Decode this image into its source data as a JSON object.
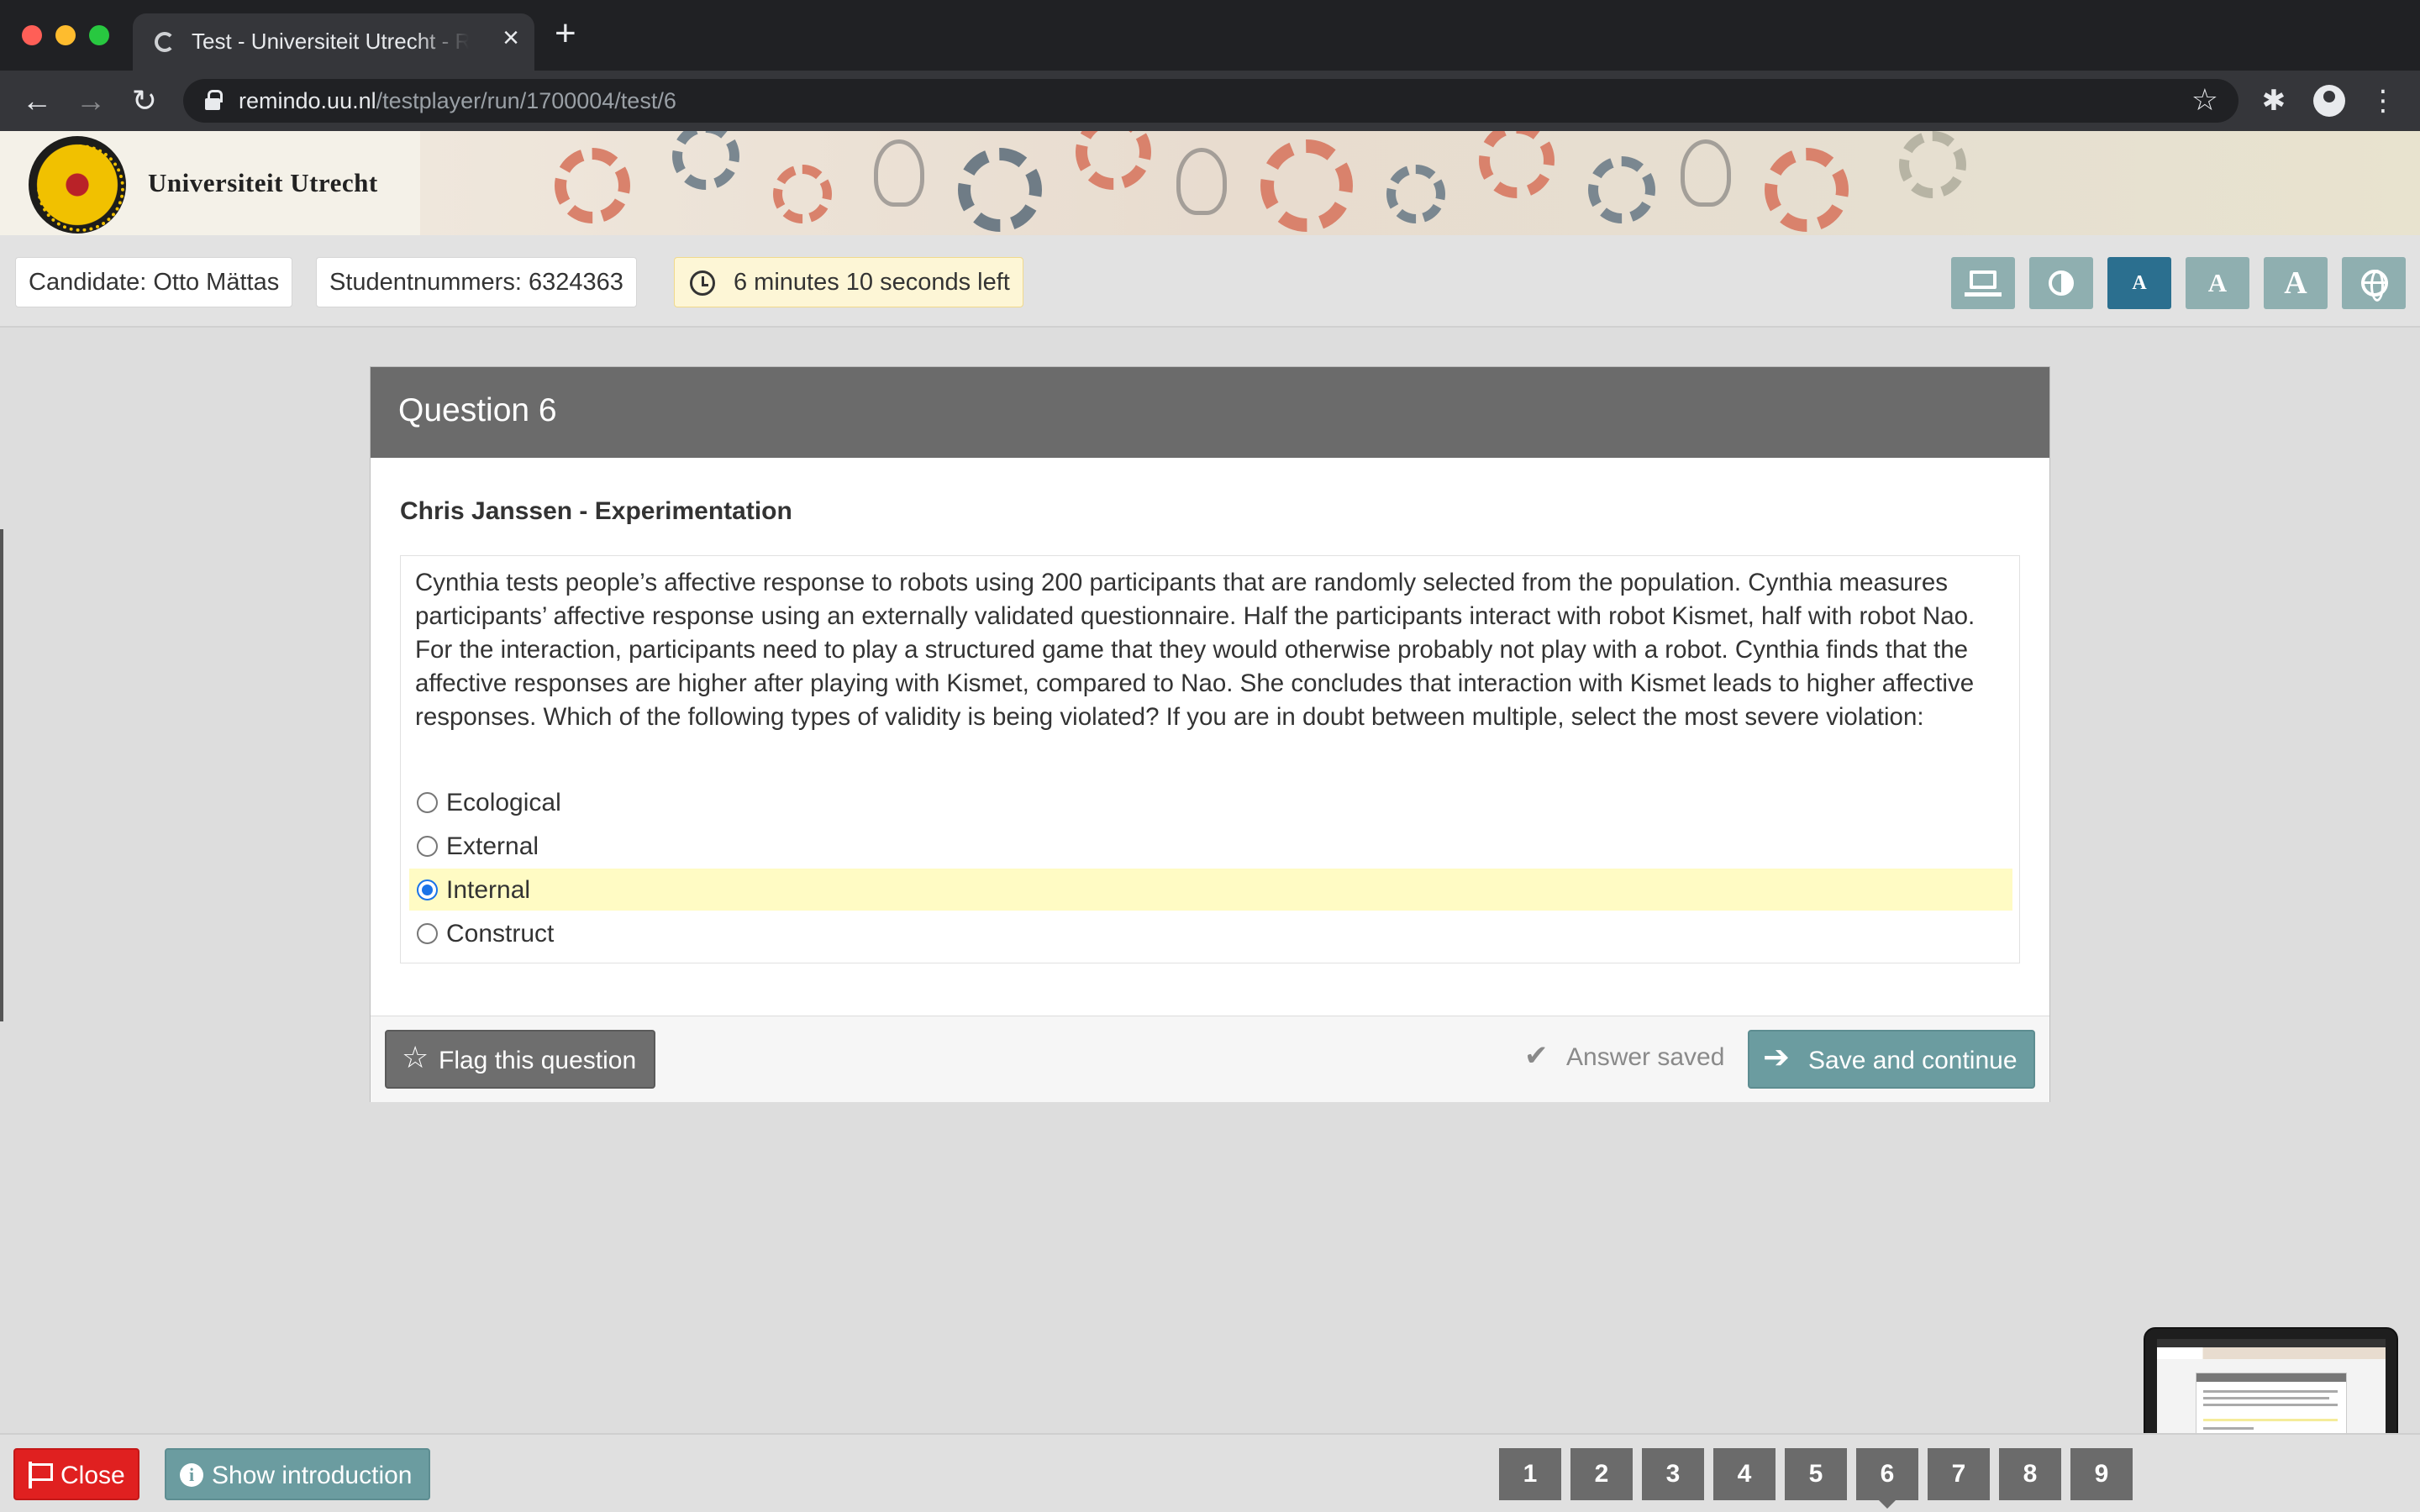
{
  "browser": {
    "tab_title": "Test - Universiteit Utrecht - Remindo",
    "url_host": "remindo.uu.nl",
    "url_path": "/testplayer/run/1700004/test/6"
  },
  "header": {
    "logo_text": "Universiteit Utrecht"
  },
  "infobar": {
    "candidate": "Candidate: Otto Mättas",
    "student_number": "Studentnummers: 6324363",
    "timer": "6 minutes 10 seconds left",
    "tools": [
      {
        "icon": "screen-icon"
      },
      {
        "icon": "contrast-icon"
      },
      {
        "icon": "font-small-icon",
        "label": "A"
      },
      {
        "icon": "font-medium-icon",
        "label": "A"
      },
      {
        "icon": "font-large-icon",
        "label": "A"
      },
      {
        "icon": "globe-icon"
      }
    ]
  },
  "question": {
    "title": "Question 6",
    "section": "Chris Janssen - Experimentation",
    "text": "Cynthia tests people’s affective response to robots using 200 participants that are randomly selected from the population. Cynthia measures participants’ affective response using an externally validated questionnaire. Half the participants interact with robot Kismet, half with robot Nao. For the interaction, participants need to play a structured game that they would otherwise probably not play with a robot. Cynthia finds that the affective responses are higher after playing with Kismet, compared to Nao. She concludes that interaction with Kismet leads to higher affective responses. Which of the following types of validity is being violated? If you are in doubt between multiple, select the most severe violation:",
    "options": [
      {
        "label": "Ecological",
        "selected": false
      },
      {
        "label": "External",
        "selected": false
      },
      {
        "label": "Internal",
        "selected": true
      },
      {
        "label": "Construct",
        "selected": false
      }
    ]
  },
  "footer": {
    "flag_label": "Flag this question",
    "saved_label": "Answer saved",
    "save_continue_label": "Save and continue"
  },
  "bottombar": {
    "close_label": "Close",
    "intro_label": "Show introduction",
    "info_glyph": "i",
    "question_numbers": [
      "1",
      "2",
      "3",
      "4",
      "5",
      "6",
      "7",
      "8",
      "9"
    ],
    "current_question": "6"
  },
  "colors": {
    "accent_teal": "#6b9ca0",
    "close_red": "#e02020",
    "selected_highlight": "#fffbc4",
    "timer_bg": "#fdf6d6",
    "active_tool": "#2b6f8f"
  }
}
